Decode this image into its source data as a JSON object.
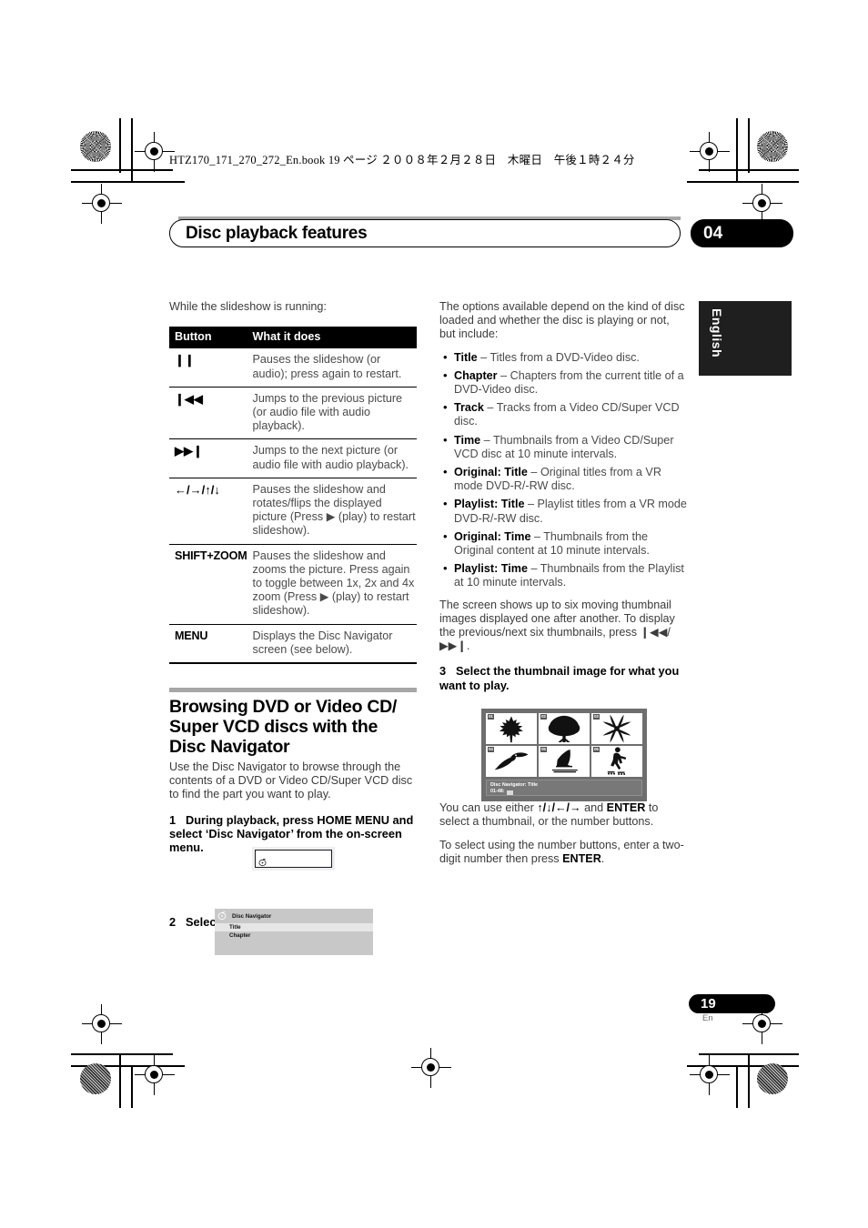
{
  "running_head": "HTZ170_171_270_272_En.book   19 ページ   ２００８年２月２８日　木曜日　午後１時２４分",
  "banner": {
    "title": "Disc playback features",
    "chapter_number": "04"
  },
  "side_tab": {
    "language": "English"
  },
  "footer": {
    "page_number": "19",
    "page_suffix": "En"
  },
  "left_column": {
    "intro": "While the slideshow is running:",
    "table": {
      "headers": [
        "Button",
        "What it does"
      ],
      "rows": [
        {
          "button": "❙❙",
          "button_kind": "symbol",
          "description": "Pauses the slideshow (or audio); press again to restart."
        },
        {
          "button": "❙◀◀",
          "button_kind": "symbol",
          "description": "Jumps to the previous picture (or audio file with audio playback)."
        },
        {
          "button": "▶▶❙",
          "button_kind": "symbol",
          "description": "Jumps to the next picture (or audio file with audio playback)."
        },
        {
          "button": "←/→/↑/↓",
          "button_kind": "symbol",
          "description": "Pauses the slideshow and rotates/flips the displayed picture (Press ▶ (play) to restart slideshow)."
        },
        {
          "button": "SHIFT+ZOOM",
          "button_kind": "text",
          "description": "Pauses the slideshow and zooms the picture. Press again to toggle between 1x, 2x and 4x zoom (Press ▶ (play) to restart slideshow)."
        },
        {
          "button": "MENU",
          "button_kind": "text",
          "description": "Displays the Disc Navigator screen (see below)."
        }
      ]
    },
    "section_heading": "Browsing DVD or Video CD/ Super VCD discs with the Disc Navigator",
    "section_intro": "Use the Disc Navigator to browse through the contents of a DVD or Video CD/Super VCD disc to find the part you want to play.",
    "step1": {
      "num": "1",
      "text": "During playback, press HOME MENU and select ‘Disc Navigator’ from the on-screen menu."
    },
    "osd_home_menu": {
      "icon": "disc-navigator-icon"
    },
    "step2": {
      "num": "2",
      "text": "Select a view option."
    },
    "osd_nav_list": {
      "title": "Disc Navigator",
      "items": [
        {
          "label": "Title",
          "selected": true
        },
        {
          "label": "Chapter",
          "selected": false
        }
      ]
    }
  },
  "right_column": {
    "intro": "The options available depend on the kind of disc loaded and whether the disc is playing or not, but include:",
    "bullets": [
      {
        "term": "Title",
        "desc": " – Titles from a DVD-Video disc."
      },
      {
        "term": "Chapter",
        "desc": " – Chapters from the current title of a DVD-Video disc."
      },
      {
        "term": "Track",
        "desc": " – Tracks from a Video CD/Super VCD disc."
      },
      {
        "term": "Time",
        "desc": " – Thumbnails from a Video CD/Super VCD disc at 10 minute intervals."
      },
      {
        "term": "Original: Title",
        "desc": " – Original titles from a VR mode DVD-R/-RW disc."
      },
      {
        "term": "Playlist: Title",
        "desc": " – Playlist titles from a VR mode DVD-R/-RW disc."
      },
      {
        "term": "Original: Time",
        "desc": " – Thumbnails from the Original content at 10 minute intervals."
      },
      {
        "term": "Playlist: Time",
        "desc": " – Thumbnails from the Playlist at 10 minute intervals."
      }
    ],
    "after_bullets": "The screen shows up to six moving thumbnail images displayed one after another. To display the previous/next six thumbnails, press ❙◀◀/ ▶▶❙.",
    "step3": {
      "num": "3",
      "text": "Select the thumbnail image for what you want to play."
    },
    "osd_thumbs": {
      "thumbnails": [
        {
          "num": "01",
          "icon": "maple-leaf-icon"
        },
        {
          "num": "02",
          "icon": "tree-icon"
        },
        {
          "num": "03",
          "icon": "lily-flower-icon"
        },
        {
          "num": "04",
          "icon": "toucan-bird-icon"
        },
        {
          "num": "05",
          "icon": "windsurfer-icon"
        },
        {
          "num": "06",
          "icon": "inline-skater-icon"
        }
      ],
      "status_line1": "Disc Navigator: Title",
      "status_line2": "01-48:"
    },
    "note1_parts": {
      "a": "You can use either ",
      "b": "↑/↓/←/→",
      "c": " and ",
      "d": "ENTER",
      "e": " to select a thumbnail, or the number buttons."
    },
    "note2_parts": {
      "a": "To select using the number buttons, enter a two-digit number then press ",
      "b": "ENTER",
      "c": "."
    }
  }
}
